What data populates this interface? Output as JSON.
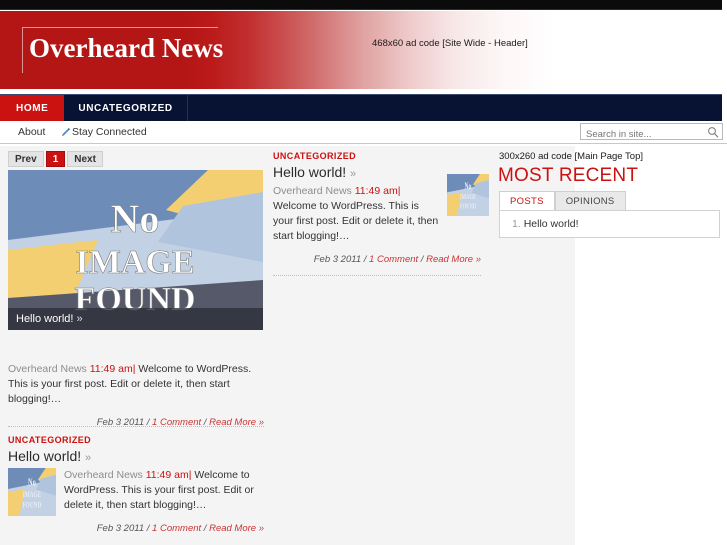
{
  "site": {
    "logo": "Overheard News",
    "header_ad": "468x60 ad code [Site Wide - Header]"
  },
  "nav": {
    "items": [
      {
        "label": "HOME",
        "active": true
      },
      {
        "label": "UNCATEGORIZED",
        "active": false
      }
    ]
  },
  "subnav": {
    "about": "About",
    "stay_connected": "Stay Connected",
    "pencil_icon": "pencil-icon"
  },
  "search": {
    "placeholder": "Search in site...",
    "icon": "search-icon"
  },
  "pager": {
    "prev": "Prev",
    "current": "1",
    "next": "Next"
  },
  "feature": {
    "placeholder_lines": [
      "No",
      "Image",
      "Found"
    ],
    "caption": "Hello world!",
    "caption_arrow": "»"
  },
  "lead": {
    "author": "Overheard News",
    "time": "11:49 am",
    "separator": "|",
    "excerpt": "Welcome to WordPress. This is your first post. Edit or delete it, then start blogging!…",
    "date": "Feb 3 2011",
    "comments": "1 Comment",
    "read_more": "Read More »",
    "meta_slash": "/"
  },
  "left_post": {
    "category": "UNCATEGORIZED",
    "title": "Hello world!",
    "title_arrow": "»",
    "author": "Overheard News",
    "time": "11:49 am",
    "separator": "|",
    "excerpt": "Welcome to WordPress. This is your first post. Edit or delete it, then start blogging!…",
    "date": "Feb 3 2011",
    "comments": "1 Comment",
    "read_more": "Read More »",
    "meta_slash": "/"
  },
  "mid_post": {
    "category": "UNCATEGORIZED",
    "title": "Hello world!",
    "title_arrow": "»",
    "author": "Overheard News",
    "time": "11:49 am",
    "separator": "|",
    "excerpt": "Welcome to WordPress. This is your first post. Edit or delete it, then start blogging!…",
    "date": "Feb 3 2011",
    "comments": "1 Comment",
    "read_more": "Read More »",
    "meta_slash": "/"
  },
  "sidebar": {
    "ad": "300x260 ad code [Main Page Top]",
    "heading": "MOST RECENT",
    "tabs": [
      {
        "label": "POSTS",
        "active": true
      },
      {
        "label": "OPINIONS",
        "active": false
      }
    ],
    "list": [
      {
        "num": "1.",
        "label": "Hello world!"
      }
    ]
  },
  "colors": {
    "brand_red": "#cc1111",
    "nav_navy": "#081334",
    "header_red": "#b41515",
    "body_text": "#333333",
    "muted": "#8d8d8d"
  }
}
